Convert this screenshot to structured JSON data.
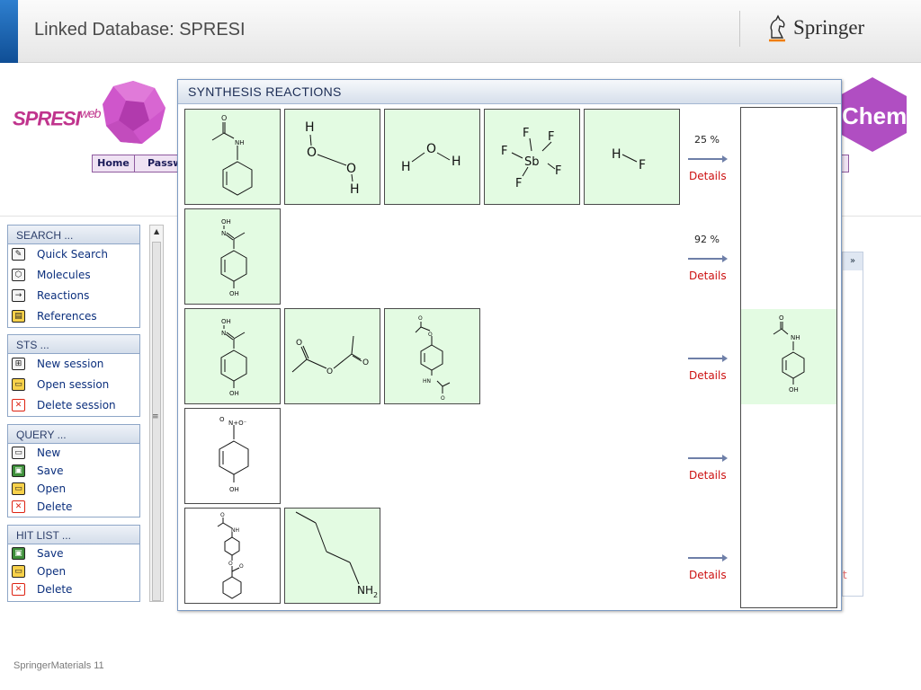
{
  "slide": {
    "title": "Linked Database: SPRESI",
    "brand": "Springer",
    "footer": "SpringerMaterials 11"
  },
  "app": {
    "logo_main": "SPRESI",
    "logo_sup": "web",
    "nav": [
      "Home",
      "Passw"
    ],
    "chem_label": "Chem",
    "side_panel_toggle": "»",
    "sidebar": {
      "search": {
        "title": "SEARCH ...",
        "items": [
          "Quick Search",
          "Molecules",
          "Reactions",
          "References"
        ]
      },
      "sts": {
        "title": "STS ...",
        "items": [
          "New session",
          "Open session",
          "Delete session"
        ]
      },
      "query": {
        "title": "QUERY ...",
        "items": [
          "New",
          "Save",
          "Open",
          "Delete"
        ]
      },
      "hitlist": {
        "title": "HIT LIST ...",
        "items": [
          "Save",
          "Open",
          "Delete"
        ]
      }
    }
  },
  "dialog": {
    "title": "SYNTHESIS REACTIONS",
    "details_label": "Details",
    "rows": [
      {
        "yield": "25 %",
        "reactants": [
          "N-phenylacetamide",
          "hydrogen peroxide",
          "water",
          "antimony pentafluoride",
          "hydrogen fluoride"
        ]
      },
      {
        "yield": "92 %",
        "reactants": [
          "4-hydroxyacetophenone oxime"
        ]
      },
      {
        "yield": "",
        "reactants": [
          "4-hydroxyacetophenone oxime",
          "acetic anhydride",
          "4-acetamidophenyl acetate"
        ]
      },
      {
        "yield": "",
        "reactants": [
          "4-nitrophenol"
        ]
      },
      {
        "yield": "",
        "reactants": [
          "4-acetamidophenyl benzoate",
          "butylamine"
        ]
      }
    ],
    "product": "paracetamol"
  },
  "colors": {
    "accent_blue": "#1b62b0",
    "molecule_bg": "#e3fbe2",
    "details_red": "#cc1111",
    "spresi_magenta": "#c0348d"
  }
}
